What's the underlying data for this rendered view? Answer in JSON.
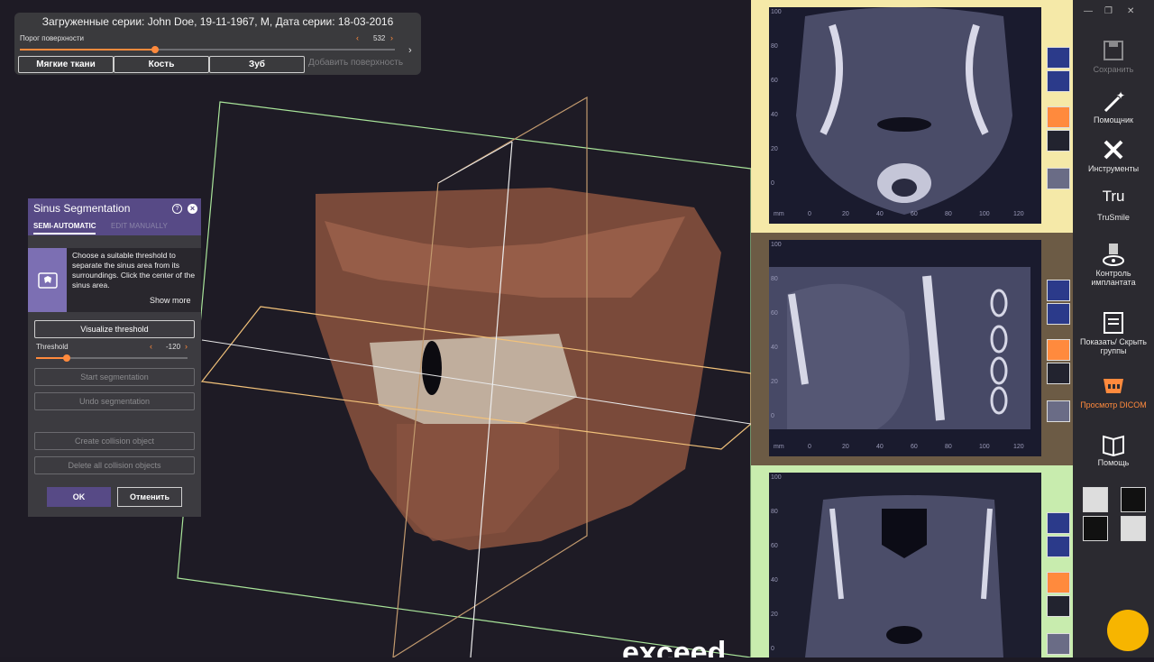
{
  "surface_panel": {
    "title": "Загруженные серии: John Doe, 19-11-1967, M, Дата серии: 18-03-2016",
    "threshold_label": "Порог поверхности",
    "threshold_value": "532",
    "threshold_fraction": 0.36,
    "buttons": [
      "Мягкие ткани",
      "Кость",
      "Зуб"
    ],
    "add_surface": "Добавить поверхность"
  },
  "sinus_panel": {
    "title": "Sinus Segmentation",
    "tabs": [
      "SEMI-AUTOMATIC",
      "EDIT MANUALLY"
    ],
    "info_text": "Choose a suitable threshold to separate the sinus area from its surroundings. Click the center of the sinus area.",
    "show_more": "Show more",
    "visualize_threshold": "Visualize threshold",
    "threshold_label": "Threshold",
    "threshold_value": "-120",
    "threshold_fraction": 0.2,
    "start_segmentation": "Start segmentation",
    "undo_segmentation": "Undo segmentation",
    "create_collision": "Create collision object",
    "delete_collision": "Delete all collision objects",
    "ok": "OK",
    "cancel": "Отменить"
  },
  "slices": {
    "ruler_y": [
      "100",
      "80",
      "60",
      "40",
      "20",
      "0"
    ],
    "ruler_x": [
      "mm",
      "0",
      "20",
      "40",
      "60",
      "80",
      "100",
      "120"
    ],
    "top_color": "#f5e9a8",
    "middle_color": "#6c5b45",
    "bottom_color": "#c8ecae"
  },
  "toolbar": {
    "save": "Сохранить",
    "assistant": "Помощник",
    "tools": "Инструменты",
    "trusmile_logo": "Tru",
    "trusmile": "TruSmile",
    "implant_control": "Контроль имплантата",
    "show_hide_groups": "Показать/ Скрыть группы",
    "dicom_view": "Просмотр DICOM",
    "help": "Помощь"
  },
  "watermark": "exceed",
  "colors": {
    "accent": "#ff8a3d",
    "purple": "#574a86"
  }
}
